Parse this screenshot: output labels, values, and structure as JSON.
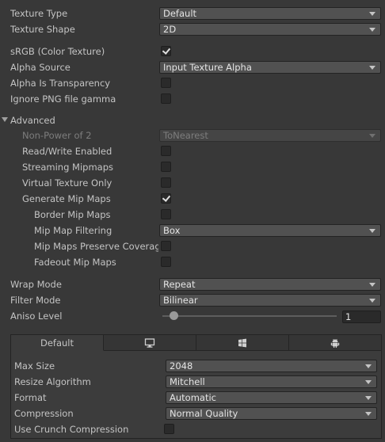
{
  "texture_type": {
    "label": "Texture Type",
    "value": "Default"
  },
  "texture_shape": {
    "label": "Texture Shape",
    "value": "2D"
  },
  "srgb": {
    "label": "sRGB (Color Texture)",
    "checked": true
  },
  "alpha_source": {
    "label": "Alpha Source",
    "value": "Input Texture Alpha"
  },
  "alpha_is_transparency": {
    "label": "Alpha Is Transparency",
    "checked": false
  },
  "ignore_png_gamma": {
    "label": "Ignore PNG file gamma",
    "checked": false
  },
  "advanced": {
    "label": "Advanced",
    "non_power_of_2": {
      "label": "Non-Power of 2",
      "value": "ToNearest"
    },
    "read_write": {
      "label": "Read/Write Enabled",
      "checked": false
    },
    "streaming_mipmaps": {
      "label": "Streaming Mipmaps",
      "checked": false
    },
    "virtual_texture_only": {
      "label": "Virtual Texture Only",
      "checked": false
    },
    "generate_mip_maps": {
      "label": "Generate Mip Maps",
      "checked": true
    },
    "border_mip_maps": {
      "label": "Border Mip Maps",
      "checked": false
    },
    "mip_map_filtering": {
      "label": "Mip Map Filtering",
      "value": "Box"
    },
    "mip_maps_preserve_coverage": {
      "label": "Mip Maps Preserve Coverag",
      "checked": false
    },
    "fadeout_mip_maps": {
      "label": "Fadeout Mip Maps",
      "checked": false
    }
  },
  "wrap_mode": {
    "label": "Wrap Mode",
    "value": "Repeat"
  },
  "filter_mode": {
    "label": "Filter Mode",
    "value": "Bilinear"
  },
  "aniso_level": {
    "label": "Aniso Level",
    "value": "1",
    "slider_fraction": 0.0
  },
  "platform_tabs": [
    {
      "label": "Default",
      "icon": null
    },
    {
      "label": "",
      "icon": "monitor-icon"
    },
    {
      "label": "",
      "icon": "windows-icon"
    },
    {
      "label": "",
      "icon": "android-icon"
    }
  ],
  "platform": {
    "max_size": {
      "label": "Max Size",
      "value": "2048"
    },
    "resize_algorithm": {
      "label": "Resize Algorithm",
      "value": "Mitchell"
    },
    "format": {
      "label": "Format",
      "value": "Automatic"
    },
    "compression": {
      "label": "Compression",
      "value": "Normal Quality"
    },
    "use_crunch": {
      "label": "Use Crunch Compression",
      "checked": false
    }
  },
  "colors": {
    "background": "#383838",
    "field": "#515151",
    "text": "#c4c4c4",
    "disabled_text": "#7d7d7d"
  }
}
